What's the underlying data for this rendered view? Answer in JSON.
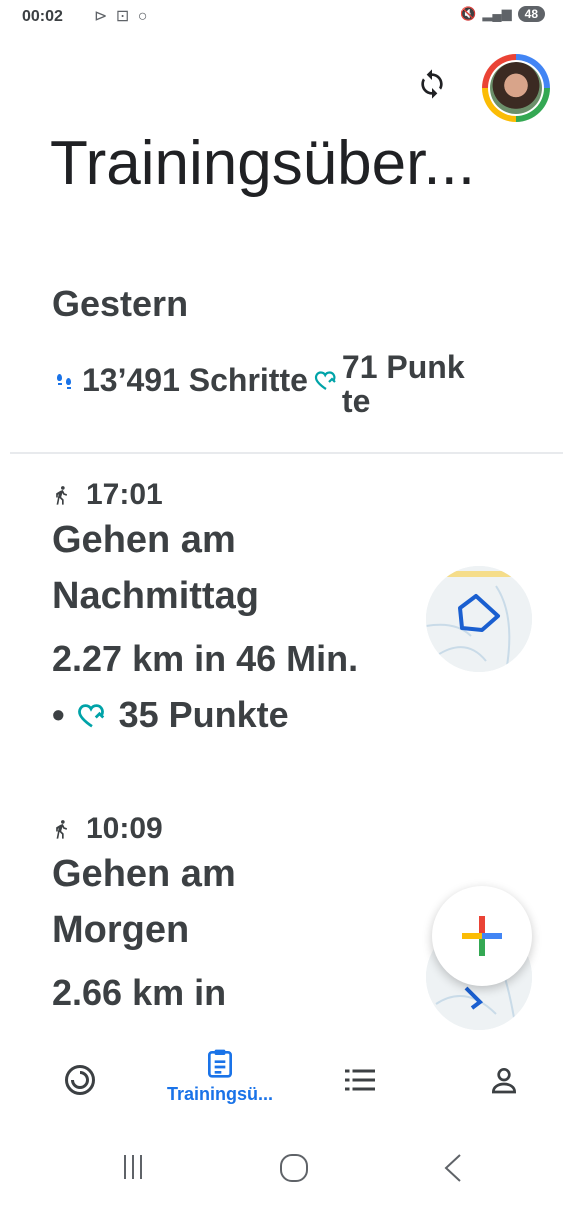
{
  "status_bar": {
    "time": "00:02",
    "left_icons": "⊳ ⊡ ○",
    "battery": "48"
  },
  "header": {
    "title": "Trainingsüber..."
  },
  "day_section": {
    "title": "Gestern",
    "steps": "13’491 Schritte",
    "points": "71 Punk te"
  },
  "activities": [
    {
      "time": "17:01",
      "name": "Gehen am Nachmittag",
      "stats": "2.27 km in 46 Min.",
      "points_prefix": "•",
      "points": "35 Punkte"
    },
    {
      "time": "10:09",
      "name": "Gehen am Morgen",
      "stats": "2.66 km in"
    }
  ],
  "bottom_nav": {
    "active_label": "Trainingsü..."
  },
  "colors": {
    "accent": "#1a73e8",
    "heart_points": "#00a3a8",
    "text": "#3c4043"
  }
}
